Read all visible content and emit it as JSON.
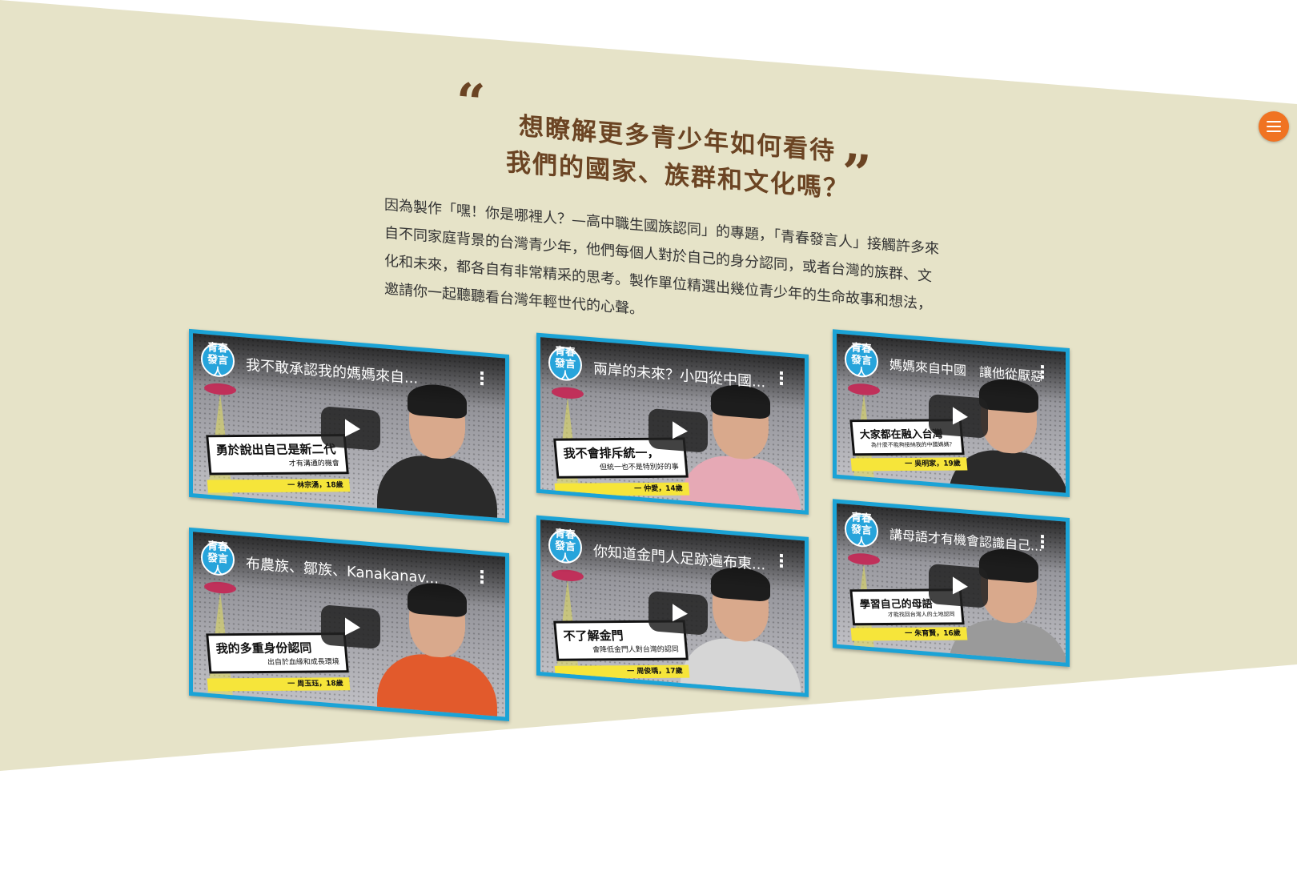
{
  "heading": {
    "open_quote": "“",
    "line1": "想瞭解更多青少年如何看待",
    "line2": "我們的國家、族群和文化嗎？",
    "close_quote": "”"
  },
  "intro": "因為製作「嘿！你是哪裡人？—高中職生國族認同」的專題，「青春發言人」接觸許多來自不同家庭背景的台灣青少年，他們每個人對於自己的身分認同，或者台灣的族群、文化和未來，都各自有非常精采的思考。製作單位精選出幾位青少年的生命故事和想法，邀請你一起聽聽看台灣年輕世代的心聲。",
  "channel_logo": "青春發言人",
  "more_icon": "⋮",
  "videos": [
    {
      "title": "我不敢承認我的媽媽來自...",
      "caption": "勇於說出自己是新二代",
      "caption_sub": "才有溝通的機會",
      "speaker": "一 林宗湧，18歲"
    },
    {
      "title": "兩岸的未來？小四從中國...",
      "caption": "我不會排斥統一，",
      "caption_sub": "但統一也不是特別好的事",
      "speaker": "一 仲愛，14歲"
    },
    {
      "title": "媽媽來自中國　讓他從厭惡...",
      "caption": "大家都在融入台灣",
      "caption_sub": "為什麼不能夠接納我的中國媽媽？",
      "speaker": "一 吳明家，19歲"
    },
    {
      "title": "布農族、鄒族、Kanakanav...",
      "caption": "我的多重身份認同",
      "caption_sub": "出自於血緣和成長環境",
      "speaker": "一 周玉珏，18歲"
    },
    {
      "title": "你知道金門人足跡遍布東...",
      "caption": "不了解金門",
      "caption_sub": "會降低金門人對台灣的認同",
      "speaker": "一 周俊瑀，17歲"
    },
    {
      "title": "講母語才有機會認識自己...",
      "caption": "學習自己的母語",
      "caption_sub": "才能找回台灣人的土地認同",
      "speaker": "一 朱育賢，16歲"
    }
  ],
  "menu": {
    "icon": "hamburger-menu-icon"
  },
  "colors": {
    "background": "#e6e3c8",
    "heading": "#6b4423",
    "card_border": "#1ba3d6",
    "menu": "#f07322",
    "caption_highlight": "#f6e53a"
  }
}
